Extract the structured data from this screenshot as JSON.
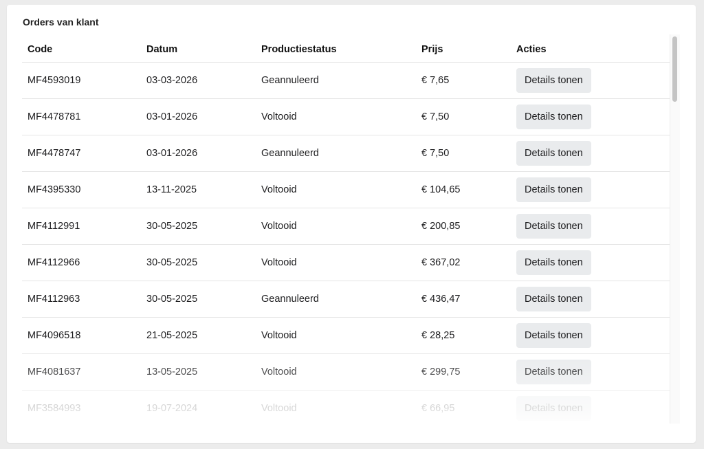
{
  "panel": {
    "title": "Orders van klant"
  },
  "table": {
    "headers": {
      "code": "Code",
      "date": "Datum",
      "status": "Productiestatus",
      "price": "Prijs",
      "actions": "Acties"
    },
    "rows": [
      {
        "code": "MF4593019",
        "date": "03-03-2026",
        "status": "Geannuleerd",
        "price": "€ 7,65",
        "action": "Details tonen"
      },
      {
        "code": "MF4478781",
        "date": "03-01-2026",
        "status": "Voltooid",
        "price": "€ 7,50",
        "action": "Details tonen"
      },
      {
        "code": "MF4478747",
        "date": "03-01-2026",
        "status": "Geannuleerd",
        "price": "€ 7,50",
        "action": "Details tonen"
      },
      {
        "code": "MF4395330",
        "date": "13-11-2025",
        "status": "Voltooid",
        "price": "€ 104,65",
        "action": "Details tonen"
      },
      {
        "code": "MF4112991",
        "date": "30-05-2025",
        "status": "Voltooid",
        "price": "€ 200,85",
        "action": "Details tonen"
      },
      {
        "code": "MF4112966",
        "date": "30-05-2025",
        "status": "Voltooid",
        "price": "€ 367,02",
        "action": "Details tonen"
      },
      {
        "code": "MF4112963",
        "date": "30-05-2025",
        "status": "Geannuleerd",
        "price": "€ 436,47",
        "action": "Details tonen"
      },
      {
        "code": "MF4096518",
        "date": "21-05-2025",
        "status": "Voltooid",
        "price": "€ 28,25",
        "action": "Details tonen"
      },
      {
        "code": "MF4081637",
        "date": "13-05-2025",
        "status": "Voltooid",
        "price": "€ 299,75",
        "action": "Details tonen"
      },
      {
        "code": "MF3584993",
        "date": "19-07-2024",
        "status": "Voltooid",
        "price": "€ 66,95",
        "action": "Details tonen"
      }
    ]
  },
  "colors": {
    "background": "#ececec",
    "card": "#ffffff",
    "button_bg": "#e9ebed",
    "row_border": "#e5e5e5",
    "scroll_thumb": "#c4c4c4"
  }
}
